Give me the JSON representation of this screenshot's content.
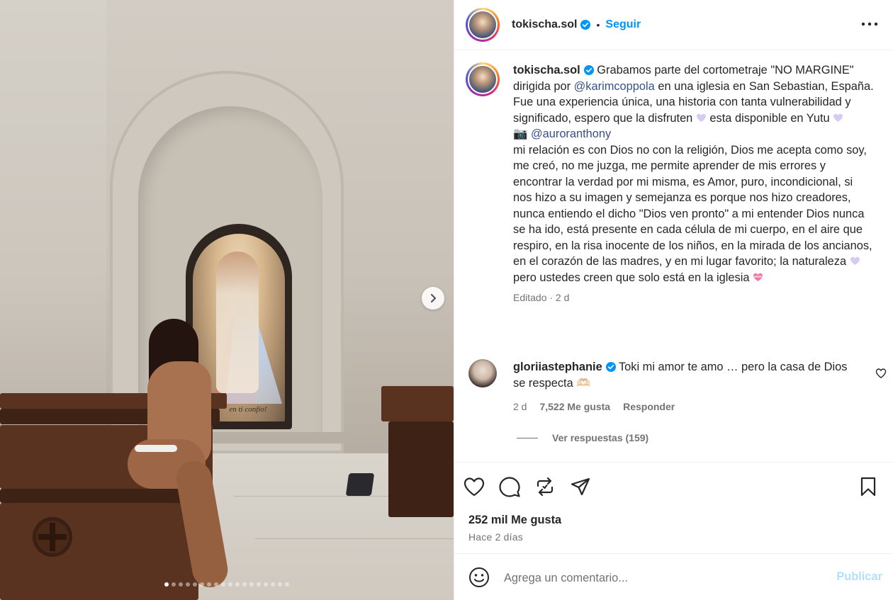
{
  "post": {
    "media_alt": "Foto del post",
    "carousel_count": 18,
    "carousel_active": 1,
    "painting_caption": "en ti confío!"
  },
  "header": {
    "username": "tokischa.sol",
    "separator": "•",
    "follow_label": "Seguir",
    "more_icon": "more-horizontal-icon"
  },
  "caption": {
    "username": "tokischa.sol",
    "t1": " Grabamos parte del cortometraje \"NO MARGINE\" dirigida por ",
    "mention1": "@karimcoppola",
    "t2": " en una iglesia en San Sebastian, España. Fue una experiencia única, una historia con tanta vulnerabilidad y significado, espero que la disfruten ",
    "t3": " esta disponible en Yutu ",
    "camera": "📷",
    "mention2": "@auroranthony",
    "t4": "mi relación es con Dios no con la religión, Dios me acepta como soy, me creó, no me juzga, me permite aprender de mis errores y encontrar la verdad por mi misma, es Amor, puro, incondicional, si nos hizo a su imagen y semejanza es porque nos hizo creadores, nunca entiendo el dicho \"Dios ven pronto\" a mi entender Dios nunca se ha ido, está presente en cada célula de mi cuerpo, en el aire que respiro, en la risa inocente de los niños, en la mirada de los ancianos, en el corazón de las madres, y en mi lugar favorito; la naturaleza ",
    "t5": " pero ustedes creen que solo está en la iglesia ",
    "edited": "Editado · 2 d"
  },
  "comment": {
    "username": "gloriiastephanie",
    "text": " Toki mi amor te amo … pero la casa de Dios se respecta ",
    "emoji": "🫶🏻",
    "time": "2 d",
    "likes": "7,522 Me gusta",
    "reply": "Responder",
    "view_replies": "Ver respuestas (159)"
  },
  "actions": {
    "likes": "252 mil Me gusta",
    "date": "Hace 2 días"
  },
  "composer": {
    "placeholder": "Agrega un comentario...",
    "post_label": "Publicar"
  },
  "colors": {
    "link": "#0095f6",
    "mention": "#385185",
    "muted": "#737373",
    "heart_lilac": "#c9b8f0",
    "heart_pink": "#e0558a"
  }
}
